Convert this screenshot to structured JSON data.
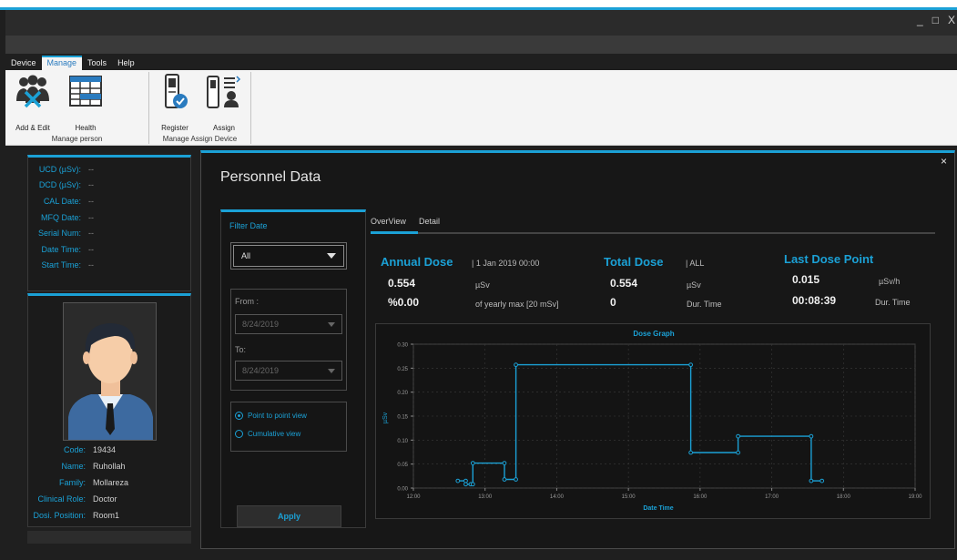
{
  "window": {
    "minimize": "_",
    "maximize": "□",
    "close": "X"
  },
  "menu": [
    {
      "label": "Device",
      "active": false
    },
    {
      "label": "Manage",
      "active": true
    },
    {
      "label": "Tools",
      "active": false
    },
    {
      "label": "Help",
      "active": false
    }
  ],
  "ribbon": {
    "group1": {
      "title": "Manage person",
      "buttons": [
        "Add & Edit",
        "Health"
      ]
    },
    "group2": {
      "title": "Manage Assign Device",
      "buttons": [
        "Register",
        "Assign"
      ]
    }
  },
  "device_info": [
    {
      "label": "UCD (µSv):",
      "value": "--"
    },
    {
      "label": "DCD (µSv):",
      "value": "--"
    },
    {
      "label": "CAL Date:",
      "value": "--"
    },
    {
      "label": "MFQ Date:",
      "value": "--"
    },
    {
      "label": "Serial Num:",
      "value": "--"
    },
    {
      "label": "Date Time:",
      "value": "--"
    },
    {
      "label": "Start Time:",
      "value": "--"
    }
  ],
  "person": [
    {
      "label": "Code:",
      "value": "19434"
    },
    {
      "label": "Name:",
      "value": "Ruhollah"
    },
    {
      "label": "Family:",
      "value": "Mollareza"
    },
    {
      "label": "Clinical Role:",
      "value": "Doctor"
    },
    {
      "label": "Dosi. Position:",
      "value": "Room1"
    }
  ],
  "dialog": {
    "title": "Personnel Data",
    "close": "×",
    "filter": {
      "title": "Filter Date",
      "select_value": "All",
      "from_label": "From :",
      "from_value": "8/24/2019",
      "to_label": "To:",
      "to_value": "8/24/2019",
      "radio1": "Point to point view",
      "radio2": "Cumulative view",
      "apply": "Apply"
    },
    "tabs": [
      "OverView",
      "Detail"
    ],
    "annual": {
      "title": "Annual Dose",
      "date": "| 1 Jan 2019 00:00",
      "value": "0.554",
      "unit": "µSv",
      "percent": "%0.00",
      "percent_note": "of yearly max [20 mSv]"
    },
    "total": {
      "title": "Total Dose",
      "scope": "| ALL",
      "value": "0.554",
      "unit": "µSv",
      "count": "0",
      "count_label": "Dur. Time"
    },
    "last": {
      "title": "Last Dose Point",
      "value": "0.015",
      "unit": "µSv/h",
      "time": "00:08:39",
      "time_label": "Dur. Time"
    }
  },
  "chart_data": {
    "type": "line",
    "title": "Dose Graph",
    "xlabel": "Date Time",
    "ylabel": "µSv",
    "x_ticks": [
      "12:00",
      "13:00",
      "14:00",
      "15:00",
      "16:00",
      "17:00",
      "18:00",
      "19:00"
    ],
    "y_ticks": [
      "0.00",
      "0.05",
      "0.10",
      "0.15",
      "0.20",
      "0.25",
      "0.30"
    ],
    "ylim": [
      0,
      0.3
    ],
    "xlim_hours": [
      12,
      19
    ],
    "line_color": "#1ba1d6",
    "steps": [
      [
        12.62,
        0.015
      ],
      [
        12.73,
        0.015
      ],
      [
        12.73,
        0.008
      ],
      [
        12.83,
        0.008
      ],
      [
        12.83,
        0.052
      ],
      [
        13.27,
        0.052
      ],
      [
        13.27,
        0.018
      ],
      [
        13.43,
        0.018
      ],
      [
        13.43,
        0.257
      ],
      [
        15.87,
        0.257
      ],
      [
        15.87,
        0.074
      ],
      [
        16.53,
        0.074
      ],
      [
        16.53,
        0.108
      ],
      [
        17.55,
        0.108
      ],
      [
        17.55,
        0.015
      ],
      [
        17.7,
        0.015
      ]
    ],
    "points": [
      [
        12.62,
        0.015
      ],
      [
        12.73,
        0.015
      ],
      [
        12.73,
        0.008
      ],
      [
        12.8,
        0.008
      ],
      [
        12.83,
        0.008
      ],
      [
        12.83,
        0.052
      ],
      [
        13.27,
        0.052
      ],
      [
        13.27,
        0.018
      ],
      [
        13.43,
        0.018
      ],
      [
        13.43,
        0.257
      ],
      [
        15.87,
        0.257
      ],
      [
        15.87,
        0.074
      ],
      [
        16.53,
        0.074
      ],
      [
        16.53,
        0.108
      ],
      [
        17.55,
        0.108
      ],
      [
        17.55,
        0.015
      ],
      [
        17.7,
        0.015
      ]
    ]
  }
}
